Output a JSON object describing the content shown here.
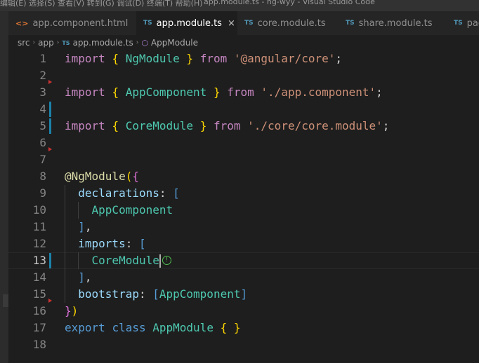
{
  "window": {
    "menu_text": "编辑(E)  选择(S)  查看(V)  转到(G)  调试(D)  终端(T)  帮助(H)",
    "title": "app.module.ts - ng-wyy - Visual Studio Code"
  },
  "tabs": [
    {
      "icon": "<>",
      "label": "app.component.html",
      "active": false
    },
    {
      "icon": "TS",
      "label": "app.module.ts",
      "active": true,
      "close": "×"
    },
    {
      "icon": "TS",
      "label": "core.module.ts",
      "active": false
    },
    {
      "icon": "TS",
      "label": "share.module.ts",
      "active": false
    },
    {
      "icon": "TS",
      "label": "pag",
      "active": false
    }
  ],
  "breadcrumb": {
    "parts": [
      "src",
      "app",
      "app.module.ts",
      "AppModule"
    ],
    "separator": "›",
    "file_icon": "TS",
    "symbol_icon": "class-symbol-icon"
  },
  "editor": {
    "active_line": "13",
    "lines": [
      {
        "n": "1",
        "tokens": [
          [
            "k",
            "import"
          ],
          [
            "p",
            " "
          ],
          [
            "b",
            "{"
          ],
          [
            "p",
            " "
          ],
          [
            "c",
            "NgModule"
          ],
          [
            "p",
            " "
          ],
          [
            "b",
            "}"
          ],
          [
            "p",
            " "
          ],
          [
            "k",
            "from"
          ],
          [
            "p",
            " "
          ],
          [
            "s",
            "'@angular/core'"
          ],
          [
            "p",
            ";"
          ]
        ]
      },
      {
        "n": "2",
        "tokens": []
      },
      {
        "n": "3",
        "tokens": [
          [
            "k",
            "import"
          ],
          [
            "p",
            " "
          ],
          [
            "b",
            "{"
          ],
          [
            "p",
            " "
          ],
          [
            "c",
            "AppComponent"
          ],
          [
            "p",
            " "
          ],
          [
            "b",
            "}"
          ],
          [
            "p",
            " "
          ],
          [
            "k",
            "from"
          ],
          [
            "p",
            " "
          ],
          [
            "s",
            "'./app.component'"
          ],
          [
            "p",
            ";"
          ]
        ]
      },
      {
        "n": "4",
        "tokens": []
      },
      {
        "n": "5",
        "tokens": [
          [
            "k",
            "import"
          ],
          [
            "p",
            " "
          ],
          [
            "b",
            "{"
          ],
          [
            "p",
            " "
          ],
          [
            "c",
            "CoreModule"
          ],
          [
            "p",
            " "
          ],
          [
            "b",
            "}"
          ],
          [
            "p",
            " "
          ],
          [
            "k",
            "from"
          ],
          [
            "p",
            " "
          ],
          [
            "s",
            "'./core/core.module'"
          ],
          [
            "p",
            ";"
          ]
        ]
      },
      {
        "n": "6",
        "tokens": []
      },
      {
        "n": "7",
        "tokens": []
      },
      {
        "n": "8",
        "tokens": [
          [
            "d",
            "@NgModule"
          ],
          [
            "b",
            "("
          ],
          [
            "b2",
            "{"
          ]
        ]
      },
      {
        "n": "9",
        "tokens": [
          [
            "p",
            "  "
          ],
          [
            "v",
            "declarations"
          ],
          [
            "p",
            ": "
          ],
          [
            "kb",
            "["
          ]
        ]
      },
      {
        "n": "10",
        "tokens": [
          [
            "p",
            "    "
          ],
          [
            "c",
            "AppComponent"
          ]
        ]
      },
      {
        "n": "11",
        "tokens": [
          [
            "p",
            "  "
          ],
          [
            "kb",
            "]"
          ],
          [
            "p",
            ","
          ]
        ]
      },
      {
        "n": "12",
        "tokens": [
          [
            "p",
            "  "
          ],
          [
            "v",
            "imports"
          ],
          [
            "p",
            ": "
          ],
          [
            "kb",
            "["
          ]
        ]
      },
      {
        "n": "13",
        "tokens": [
          [
            "p",
            "    "
          ],
          [
            "c",
            "CoreModule"
          ]
        ]
      },
      {
        "n": "14",
        "tokens": [
          [
            "p",
            "  "
          ],
          [
            "kb",
            "]"
          ],
          [
            "p",
            ","
          ]
        ]
      },
      {
        "n": "15",
        "tokens": [
          [
            "p",
            "  "
          ],
          [
            "v",
            "bootstrap"
          ],
          [
            "p",
            ": "
          ],
          [
            "kb",
            "["
          ],
          [
            "c",
            "AppComponent"
          ],
          [
            "kb",
            "]"
          ]
        ]
      },
      {
        "n": "16",
        "tokens": [
          [
            "b2",
            "}"
          ],
          [
            "b",
            ")"
          ]
        ]
      },
      {
        "n": "17",
        "tokens": [
          [
            "kb",
            "export"
          ],
          [
            "p",
            " "
          ],
          [
            "kb",
            "class"
          ],
          [
            "p",
            " "
          ],
          [
            "c",
            "AppModule"
          ],
          [
            "p",
            " "
          ],
          [
            "b",
            "{"
          ],
          [
            "p",
            " "
          ],
          [
            "b",
            "}"
          ]
        ]
      },
      {
        "n": "18",
        "tokens": []
      }
    ],
    "lightbulb_glyph": "!"
  },
  "colors": {
    "background": "#1e1e1e",
    "keyword_control": "#c586c0",
    "keyword": "#569cd6",
    "string": "#ce9178",
    "type": "#4ec9b0",
    "property": "#9cdcfe",
    "bracket": "#ffd700",
    "decorator": "#dcdcaa",
    "git_modified": "#1b81a8",
    "git_deleted": "#cc3333"
  }
}
